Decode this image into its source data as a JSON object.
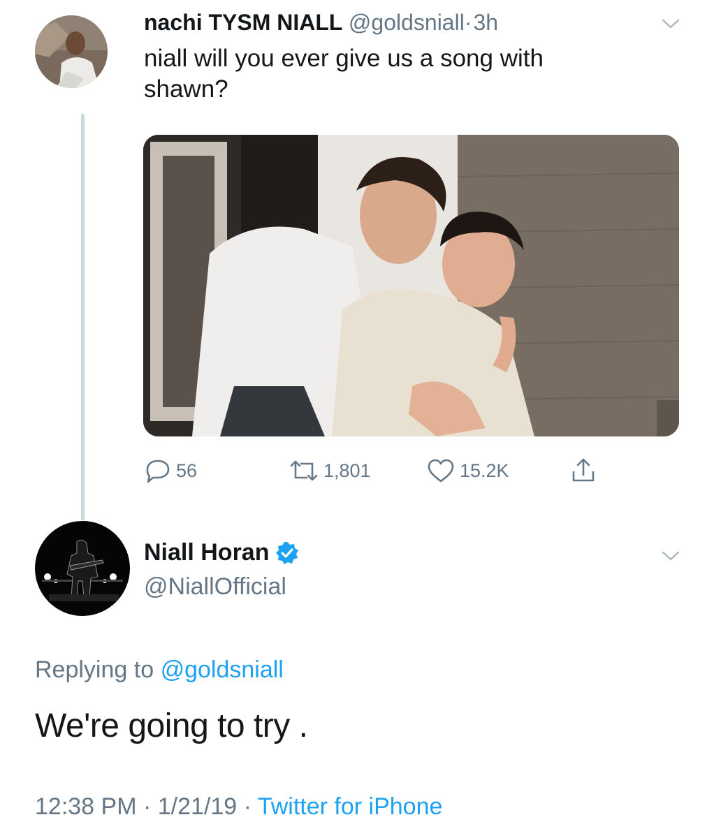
{
  "original_tweet": {
    "display_name": "nachi TYSM NIALL",
    "handle": "@goldsniall",
    "separator": "·",
    "time": "3h",
    "text": "niall will you ever give us a song with shawn?",
    "text_line1": "niall will you ever give us a song with",
    "text_line2": "shawn?",
    "actions": {
      "replies": "56",
      "retweets": "1,801",
      "likes": "15.2K"
    }
  },
  "reply_tweet": {
    "display_name": "Niall Horan",
    "handle": "@NiallOfficial",
    "replying_prefix": "Replying to",
    "replying_handle": "@goldsniall",
    "text": "We're going to try .",
    "time": "12:38 PM",
    "date": "1/21/19",
    "separator": "·",
    "source": "Twitter for iPhone"
  },
  "colors": {
    "link": "#1da1f2",
    "secondary_text": "#657786",
    "primary_text": "#14171a",
    "thread_line": "#ccd6dd",
    "verified": "#1da1f2"
  },
  "icons": [
    "chevron-down-icon",
    "reply-icon",
    "retweet-icon",
    "like-icon",
    "share-icon",
    "verified-badge-icon"
  ]
}
